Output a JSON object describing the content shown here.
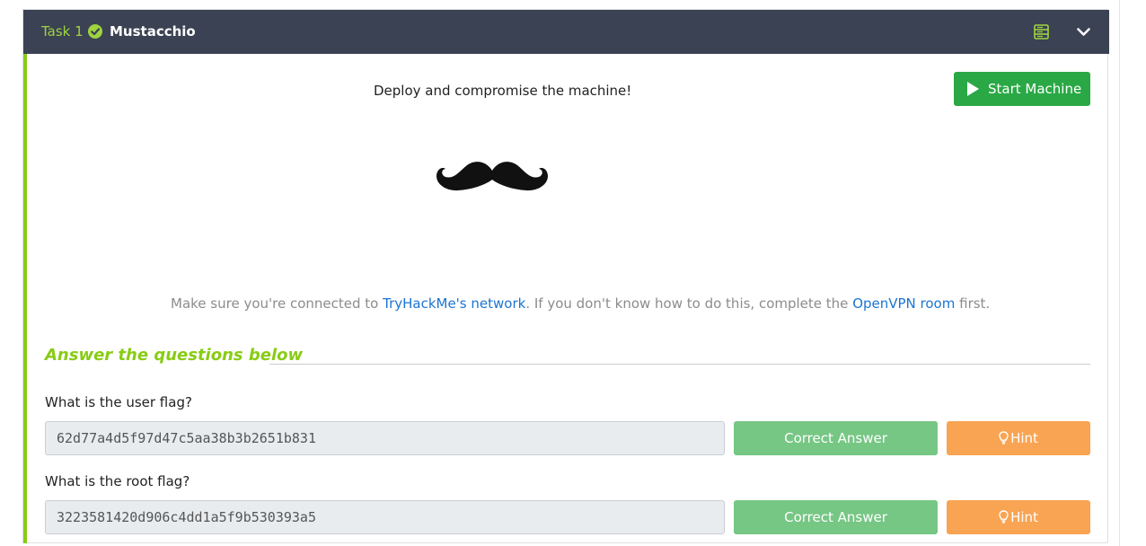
{
  "task": {
    "number_label": "Task 1",
    "title": "Mustacchio"
  },
  "body": {
    "deploy_text": "Deploy and compromise the machine!",
    "start_button_label": "Start Machine",
    "connect_note": {
      "prefix": "Make sure you're connected to ",
      "network_link": "TryHackMe's network",
      "middle": ". If you don't know how to do this, complete the ",
      "openvpn_link": "OpenVPN room",
      "suffix": " first."
    }
  },
  "answers": {
    "heading": "Answer the questions below",
    "questions": [
      {
        "question": "What is the user flag?",
        "answer": "62d77a4d5f97d47c5aa38b3b2651b831",
        "correct_label": "Correct Answer",
        "hint_label": "Hint"
      },
      {
        "question": "What is the root flag?",
        "answer": "3223581420d906c4dd1a5f9b530393a5",
        "correct_label": "Correct Answer",
        "hint_label": "Hint"
      }
    ]
  },
  "colors": {
    "header_bg": "#3a4253",
    "accent_green": "#88cc14",
    "start_green": "#2aa845",
    "correct_green": "#76c684",
    "hint_orange": "#f9a452",
    "link_blue": "#1c75d2"
  },
  "icons": [
    "check-circle-icon",
    "server-icon",
    "chevron-down-icon",
    "play-icon",
    "mustache-image",
    "lightbulb-icon"
  ]
}
